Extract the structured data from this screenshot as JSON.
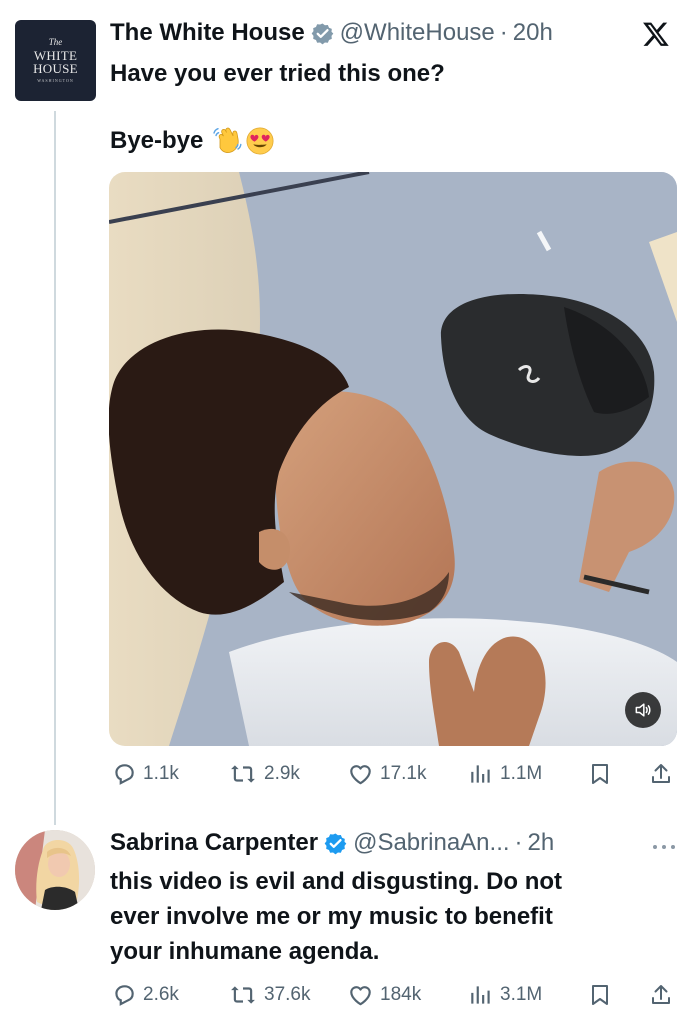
{
  "tweets": [
    {
      "avatar": {
        "the": "The",
        "line1": "WHITE",
        "line2": "HOUSE",
        "caption": "WASHINGTON"
      },
      "name": "The White House",
      "handle": "@WhiteHouse",
      "time": "20h",
      "lines": [
        "Have you ever tried this one?",
        "Bye-bye"
      ],
      "emojis": [
        "waving-hand",
        "heart-eyes"
      ],
      "stats": {
        "replies": "1.1k",
        "reposts": "2.9k",
        "likes": "17.1k",
        "views": "1.1M"
      }
    },
    {
      "name": "Sabrina Carpenter",
      "handle": "@SabrinaAn...",
      "time": "2h",
      "lines": [
        "this video is evil and disgusting. Do not",
        "ever involve me or my music to benefit",
        "your inhumane agenda."
      ],
      "stats": {
        "replies": "2.6k",
        "reposts": "37.6k",
        "likes": "184k",
        "views": "3.1M"
      }
    }
  ],
  "colors": {
    "verified": "#1d9bf0",
    "text": "#0f1419",
    "muted": "#536471"
  },
  "icons": [
    "verified-badge-icon",
    "x-logo-icon",
    "reply-icon",
    "repost-icon",
    "like-icon",
    "views-icon",
    "bookmark-icon",
    "share-icon",
    "mute-icon",
    "more-icon"
  ]
}
